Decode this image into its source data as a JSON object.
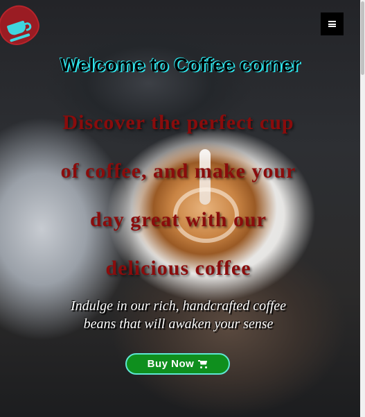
{
  "header": {
    "logo_icon": "coffee-cup-icon",
    "menu_icon": "hamburger-menu-icon"
  },
  "hero": {
    "welcome": "Welcome to Coffee corner",
    "headline_lines": [
      "Discover the perfect cup",
      "of coffee, and make your",
      "day great with our",
      "delicious coffee"
    ],
    "tagline_lines": [
      "Indulge in our rich, handcrafted coffee",
      "beans that will awaken your sense"
    ],
    "buy_button": {
      "label": "Buy Now",
      "icon": "shopping-cart-icon"
    }
  },
  "colors": {
    "logo_bg": "#9a1c23",
    "logo_cup": "#3fd6df",
    "welcome_shadow": "#2ee7ee",
    "headline": "#8a0c0c",
    "buy_button_bg": "#0f8f1e",
    "buy_button_border": "#5ee7d4"
  }
}
